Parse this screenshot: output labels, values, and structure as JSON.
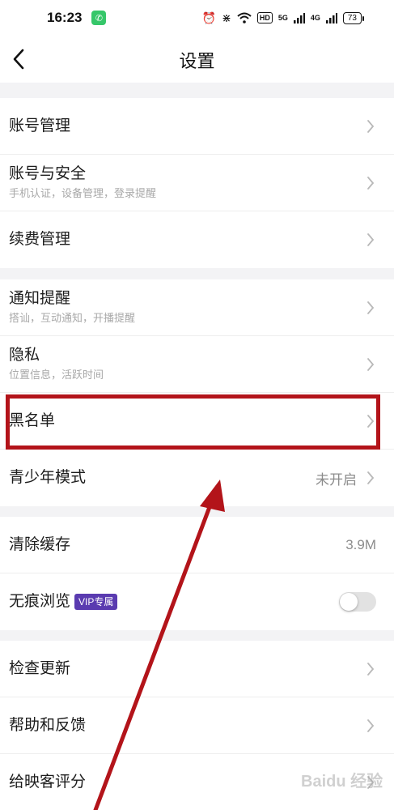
{
  "status_bar": {
    "time": "16:23",
    "network_type": "HD",
    "signal_1": "5G",
    "signal_2": "4G",
    "battery": "73"
  },
  "nav": {
    "title": "设置"
  },
  "groups": [
    {
      "items": [
        {
          "title": "账号管理"
        },
        {
          "title": "账号与安全",
          "subtitle": "手机认证，设备管理，登录提醒"
        },
        {
          "title": "续费管理"
        }
      ]
    },
    {
      "items": [
        {
          "title": "通知提醒",
          "subtitle": "搭讪，互动通知，开播提醒"
        },
        {
          "title": "隐私",
          "subtitle": "位置信息，活跃时间"
        },
        {
          "title": "黑名单"
        },
        {
          "title": "青少年模式",
          "value": "未开启"
        }
      ]
    },
    {
      "items": [
        {
          "title": "清除缓存",
          "value": "3.9M"
        },
        {
          "title": "无痕浏览",
          "badge": "VIP专属",
          "toggle_on": false
        }
      ]
    },
    {
      "items": [
        {
          "title": "检查更新"
        },
        {
          "title": "帮助和反馈"
        },
        {
          "title": "给映客评分"
        }
      ]
    }
  ],
  "annotation": {
    "highlight_color": "#b3141a"
  },
  "watermark": "Baidu 经验"
}
